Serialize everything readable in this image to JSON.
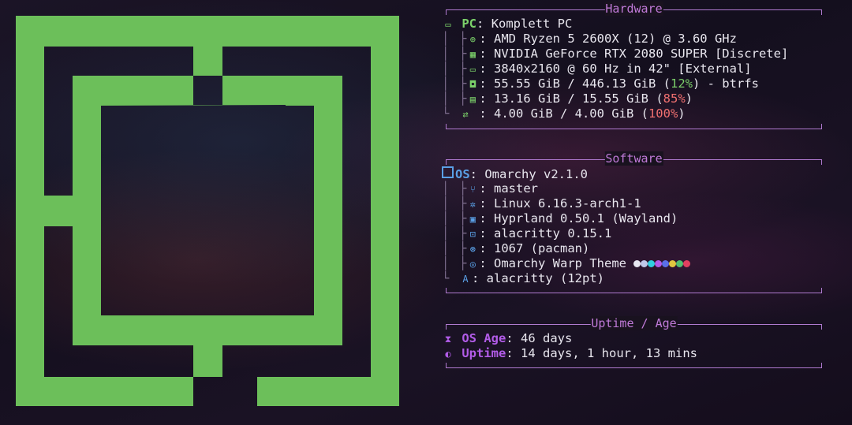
{
  "colors": {
    "logo_green": "#6cbf5a",
    "section_border": "#b07ad0",
    "hardware_key": "#7bd06a",
    "software_key": "#5aa0e6",
    "uptime_key": "#b25ce8",
    "pct_ok": "#7bd06a",
    "pct_high": "#f07070"
  },
  "hardware": {
    "title": "Hardware",
    "pc_key": "PC",
    "pc_value": "Komplett PC",
    "cpu_icon": "cpu-icon",
    "cpu_value": "AMD Ryzen 5 2600X (12) @ 3.60 GHz",
    "gpu_icon": "gpu-icon",
    "gpu_value": "NVIDIA GeForce RTX 2080 SUPER [Discrete]",
    "display_icon": "monitor-icon",
    "display_value": "3840x2160 @ 60 Hz in 42\" [External]",
    "disk_icon": "disk-icon",
    "disk_used": "55.55 GiB / 446.13 GiB (",
    "disk_pct": "12%",
    "disk_tail": ") - btrfs",
    "mem_icon": "memory-icon",
    "mem_used": "13.16 GiB / 15.55 GiB (",
    "mem_pct": "85%",
    "mem_tail": ")",
    "swap_icon": "swap-icon",
    "swap_used": " : 4.00 GiB / 4.00 GiB (",
    "swap_pct": "100%",
    "swap_tail": ")"
  },
  "software": {
    "title": "Software",
    "os_key": "OS",
    "os_value": "Omarchy v2.1.0",
    "branch_value": "master",
    "kernel_value": "Linux 6.16.3-arch1-1",
    "wm_value": "Hyprland 0.50.1 (Wayland)",
    "terminal_value": "alacritty 0.15.1",
    "packages_value": "1067 (pacman)",
    "theme_value": "Omarchy Warp Theme",
    "theme_colors": [
      "#e6e6f0",
      "#c0c8ea",
      "#2fd0e0",
      "#b05ce8",
      "#5a70e8",
      "#e0c840",
      "#50c070",
      "#e04060"
    ],
    "font_value": "alacritty (12pt)"
  },
  "uptime": {
    "title": "Uptime / Age",
    "os_age_key": "OS Age",
    "os_age_value": "46 days",
    "uptime_key": "Uptime",
    "uptime_value": "14 days, 1 hour, 13 mins"
  }
}
